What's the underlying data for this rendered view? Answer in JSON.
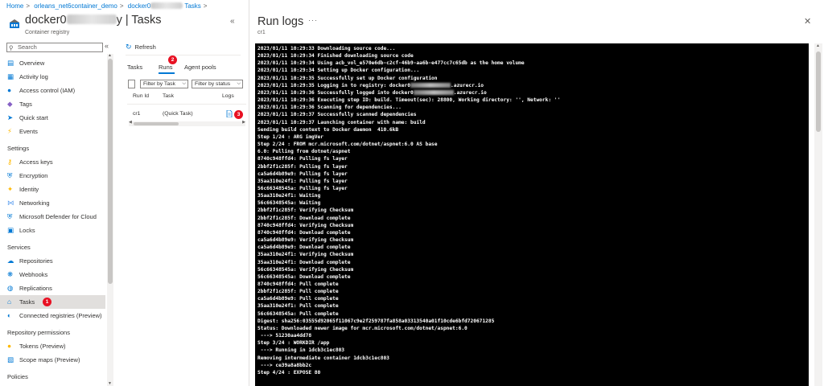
{
  "breadcrumb": {
    "home": "Home",
    "demo": "orleans_net6container_demo",
    "registry_prefix": "docker0",
    "tasks": "Tasks"
  },
  "header": {
    "name_prefix": "docker0",
    "name_suffix": "y",
    "title_sep": "| Tasks",
    "subtitle": "Container registry"
  },
  "nav": {
    "search_placeholder": "Search",
    "items_top": [
      {
        "label": "Overview",
        "icon": "overview-icon",
        "color": "#0078d4"
      },
      {
        "label": "Activity log",
        "icon": "activity-log-icon",
        "color": "#0078d4"
      },
      {
        "label": "Access control (IAM)",
        "icon": "people-icon",
        "color": "#0078d4"
      },
      {
        "label": "Tags",
        "icon": "tag-icon",
        "color": "#8661c5"
      },
      {
        "label": "Quick start",
        "icon": "rocket-icon",
        "color": "#0078d4"
      },
      {
        "label": "Events",
        "icon": "lightning-icon",
        "color": "#ffb900"
      }
    ],
    "section_settings": "Settings",
    "items_settings": [
      {
        "label": "Access keys",
        "icon": "key-icon",
        "color": "#ffb900"
      },
      {
        "label": "Encryption",
        "icon": "shield-icon",
        "color": "#0078d4"
      },
      {
        "label": "Identity",
        "icon": "identity-icon",
        "color": "#ffb900"
      },
      {
        "label": "Networking",
        "icon": "network-icon",
        "color": "#5ea0ef"
      },
      {
        "label": "Microsoft Defender for Cloud",
        "icon": "defender-icon",
        "color": "#0078d4"
      },
      {
        "label": "Locks",
        "icon": "lock-icon",
        "color": "#0078d4"
      }
    ],
    "section_services": "Services",
    "items_services": [
      {
        "label": "Repositories",
        "icon": "cloud-icon",
        "color": "#0078d4"
      },
      {
        "label": "Webhooks",
        "icon": "webhook-icon",
        "color": "#0078d4"
      },
      {
        "label": "Replications",
        "icon": "globe-icon",
        "color": "#0078d4"
      },
      {
        "label": "Tasks",
        "icon": "registry-icon",
        "color": "#0078d4"
      },
      {
        "label": "Connected registries (Preview)",
        "icon": "connected-icon",
        "color": "#0078d4"
      }
    ],
    "section_permissions": "Repository permissions",
    "items_permissions": [
      {
        "label": "Tokens (Preview)",
        "icon": "token-icon",
        "color": "#ffb900"
      },
      {
        "label": "Scope maps (Preview)",
        "icon": "scope-map-icon",
        "color": "#0078d4"
      }
    ],
    "section_policies": "Policies",
    "badge_tasks": "1"
  },
  "blade": {
    "refresh_label": "Refresh",
    "tabs": [
      "Tasks",
      "Runs",
      "Agent pools"
    ],
    "badge_runs": "2",
    "filter_task": "Filter by Task",
    "filter_status": "Filter by status",
    "columns": [
      "Run Id",
      "Task",
      "Logs"
    ],
    "rows": [
      {
        "run_id": "cr1",
        "task": "(Quick Task)"
      }
    ],
    "badge_logs": "3"
  },
  "run_logs": {
    "title": "Run logs",
    "more": "···",
    "subtitle": "cr1",
    "lines": [
      "2023/01/11 10:29:33 Downloading source code...",
      "2023/01/11 10:29:34 Finished downloading source code",
      "2023/01/11 10:29:34 Using acb_vol_e570e6db-c2cf-46b9-aa6b-e477cc7c65db as the home volume",
      "2023/01/11 10:29:34 Setting up Docker configuration...",
      "2023/01/11 10:29:35 Successfully set up Docker configuration",
      "2023/01/11 10:29:35 Logging in to registry: docker0",
      "2023/01/11 10:29:36 Successfully logged into docker0",
      "2023/01/11 10:29:36 Executing step ID: build. Timeout(sec): 28800, Working directory: '', Network: ''",
      "2023/01/11 10:29:36 Scanning for dependencies...",
      "2023/01/11 10:29:37 Successfully scanned dependencies",
      "2023/01/11 10:29:37 Launching container with name: build",
      "Sending build context to Docker daemon  410.6kB",
      "Step 1/24 : ARG imgVer",
      "Step 2/24 : FROM mcr.microsoft.com/dotnet/aspnet:6.0 AS base",
      "6.0: Pulling from dotnet/aspnet",
      "8740c948ffd4: Pulling fs layer",
      "2bbf2f1c285f: Pulling fs layer",
      "ca5a6d4b89e9: Pulling fs layer",
      "35aa310e24f1: Pulling fs layer",
      "56c66348545a: Pulling fs layer",
      "35aa310e24f1: Waiting",
      "56c66348545a: Waiting",
      "2bbf2f1c285f: Verifying Checksum",
      "2bbf2f1c285f: Download complete",
      "8740c948ffd4: Verifying Checksum",
      "8740c948ffd4: Download complete",
      "ca5a6d4b89e9: Verifying Checksum",
      "ca5a6d4b89e9: Download complete",
      "35aa310e24f1: Verifying Checksum",
      "35aa310e24f1: Download complete",
      "56c66348545a: Verifying Checksum",
      "56c66348545a: Download complete",
      "8740c948ffd4: Pull complete",
      "2bbf2f1c285f: Pull complete",
      "ca5a6d4b89e9: Pull complete",
      "35aa310e24f1: Pull complete",
      "56c66348545a: Pull complete",
      "Digest: sha256:03555d92065f11067c9e2f259787fa858a03313540a01f10cde6bfd720671285",
      "Status: Downloaded newer image for mcr.microsoft.com/dotnet/aspnet:6.0",
      " ---> 51230aa4dd78",
      "Step 3/24 : WORKDIR /app",
      " ---> Running in 1dcb3c1ec803",
      "Removing intermediate container 1dcb3c1ec803",
      " ---> ce39a8a8bb2c",
      "Step 4/24 : EXPOSE 80"
    ],
    "registry_suffix": ".azurecr.io"
  }
}
